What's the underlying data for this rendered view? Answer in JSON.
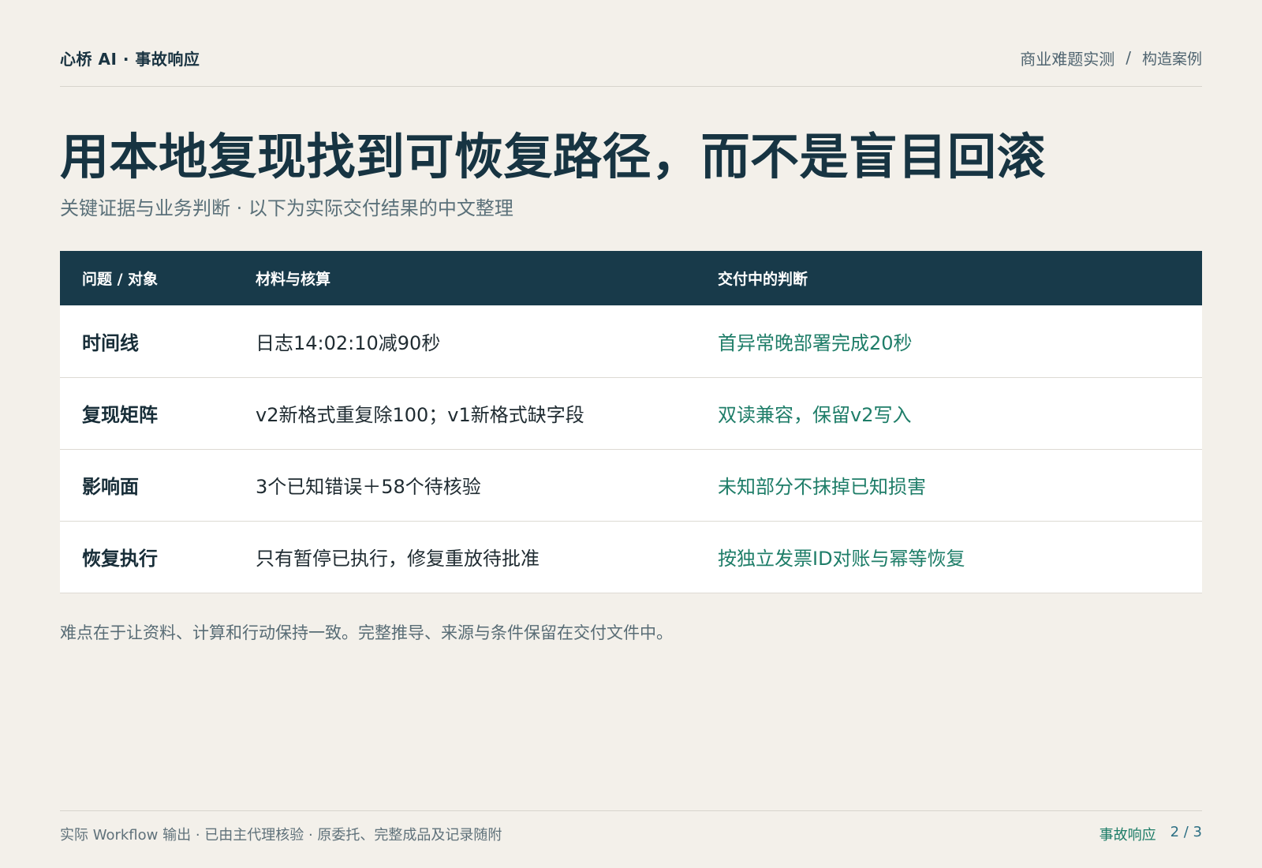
{
  "header": {
    "brand": "心桥 AI · 事故响应",
    "crumb_1": "商业难题实测",
    "separator": "/",
    "crumb_2": "构造案例"
  },
  "title": "用本地复现找到可恢复路径，而不是盲目回滚",
  "subtitle": "关键证据与业务判断 · 以下为实际交付结果的中文整理",
  "table": {
    "headers": [
      "问题 / 对象",
      "材料与核算",
      "交付中的判断"
    ],
    "rows": [
      {
        "issue": "时间线",
        "material": "日志14:02:10减90秒",
        "judgment": "首异常晚部署完成20秒"
      },
      {
        "issue": "复现矩阵",
        "material": "v2新格式重复除100；v1新格式缺字段",
        "judgment": "双读兼容，保留v2写入"
      },
      {
        "issue": "影响面",
        "material": "3个已知错误＋58个待核验",
        "judgment": "未知部分不抹掉已知损害"
      },
      {
        "issue": "恢复执行",
        "material": "只有暂停已执行，修复重放待批准",
        "judgment": "按独立发票ID对账与幂等恢复"
      }
    ]
  },
  "note": "难点在于让资料、计算和行动保持一致。完整推导、来源与条件保留在交付文件中。",
  "footer": {
    "left": "实际 Workflow 输出 · 已由主代理核验 · 原委托、完整成品及记录随附",
    "section": "事故响应",
    "page": "2 / 3"
  }
}
